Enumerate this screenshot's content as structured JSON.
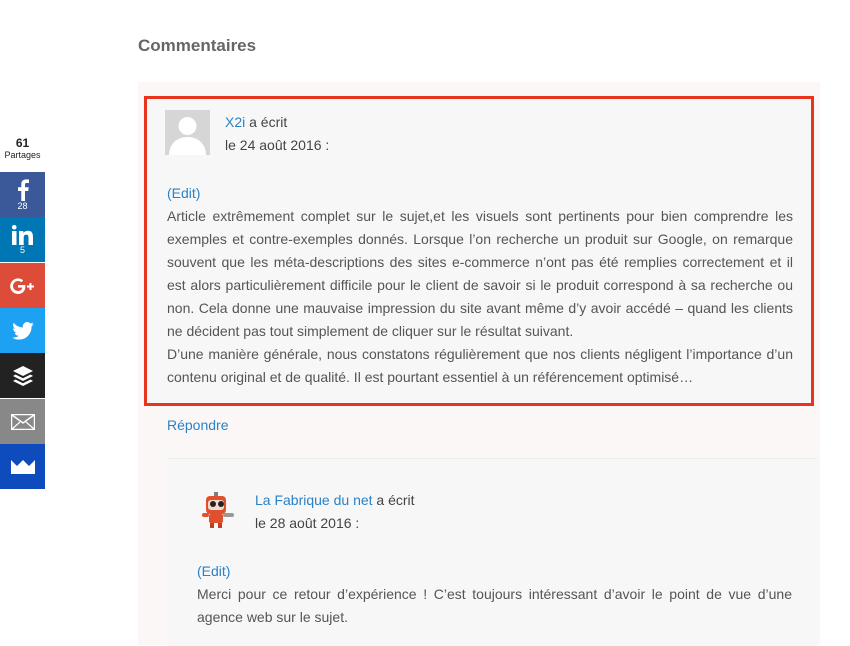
{
  "share": {
    "total": "61",
    "total_label": "Partages",
    "facebook_count": "28",
    "linkedin_count": "5"
  },
  "section_title": "Commentaires",
  "comments": [
    {
      "author": "X2i",
      "wrote": " a écrit",
      "date": "le 24 août 2016 :",
      "edit": "(Edit)",
      "paragraphs": [
        "Article extrêmement complet sur le sujet,et les visuels sont pertinents pour bien comprendre les exemples et contre-exemples donnés. Lorsque l’on recherche un produit sur Google, on remarque souvent que les méta-descriptions des sites e-commerce n’ont pas été remplies correctement et il est alors particulièrement difficile pour le client de savoir si le produit correspond à sa recherche ou non. Cela donne une mauvaise impression du site avant même d’y avoir accédé – quand les clients ne décident pas tout simplement de cliquer sur le résultat suivant.",
        "D’une manière générale, nous constatons régulièrement que nos clients négligent l’importance d’un contenu original et de qualité. Il est pourtant essentiel à un référencement optimisé…"
      ],
      "reply_label": "Répondre"
    },
    {
      "author": "La Fabrique du net",
      "wrote": " a écrit",
      "date": "le 28 août 2016 :",
      "edit": "(Edit)",
      "paragraphs": [
        "Merci pour ce retour d’expérience ! C’est toujours intéressant d’avoir le point de vue d’une agence web sur le sujet."
      ]
    }
  ],
  "colors": {
    "link": "#2a82c6",
    "highlight_border": "#e8341c",
    "facebook": "#3b5998",
    "linkedin": "#0077b5",
    "googleplus": "#dd4b39",
    "twitter": "#1da1f2",
    "buffer": "#222222",
    "email": "#888888",
    "sumome": "#0e4bbd"
  }
}
